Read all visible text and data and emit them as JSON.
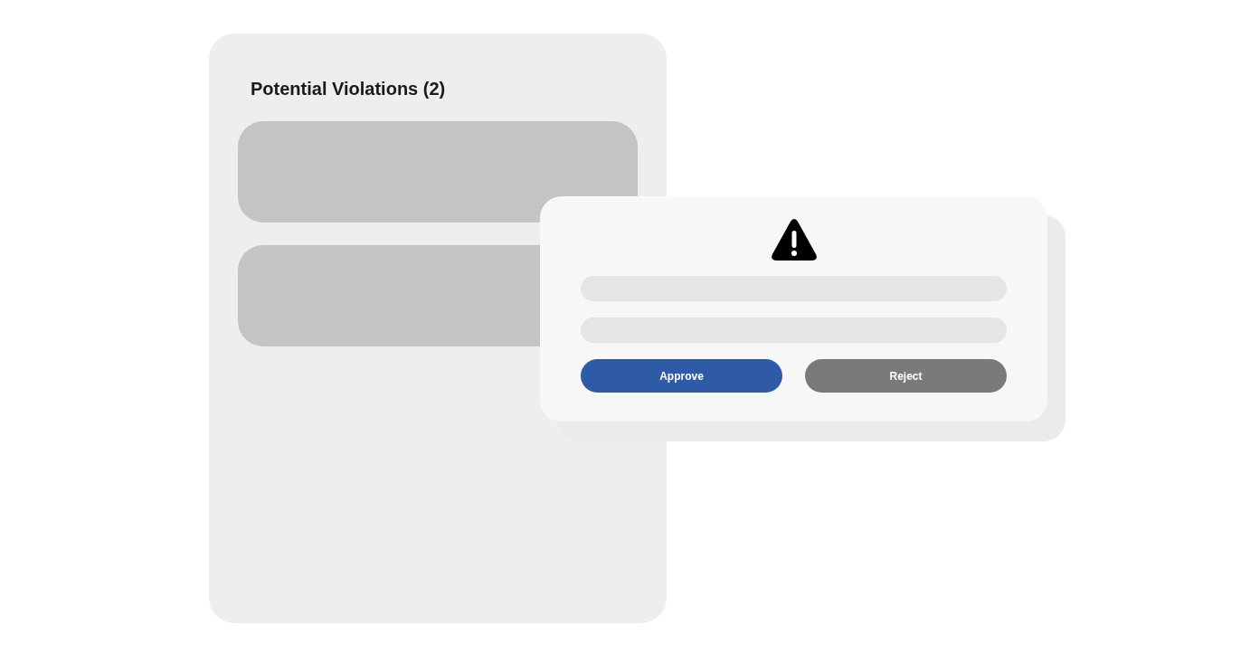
{
  "panel": {
    "title": "Potential Violations (2)",
    "cards": [
      {
        "kind": "placeholder"
      },
      {
        "kind": "placeholder"
      }
    ]
  },
  "dialog": {
    "lines": [
      {
        "kind": "placeholder"
      },
      {
        "kind": "placeholder"
      }
    ],
    "buttons": [
      {
        "label": "Approve",
        "kind": "primary"
      },
      {
        "label": "Reject",
        "kind": "secondary"
      }
    ]
  }
}
